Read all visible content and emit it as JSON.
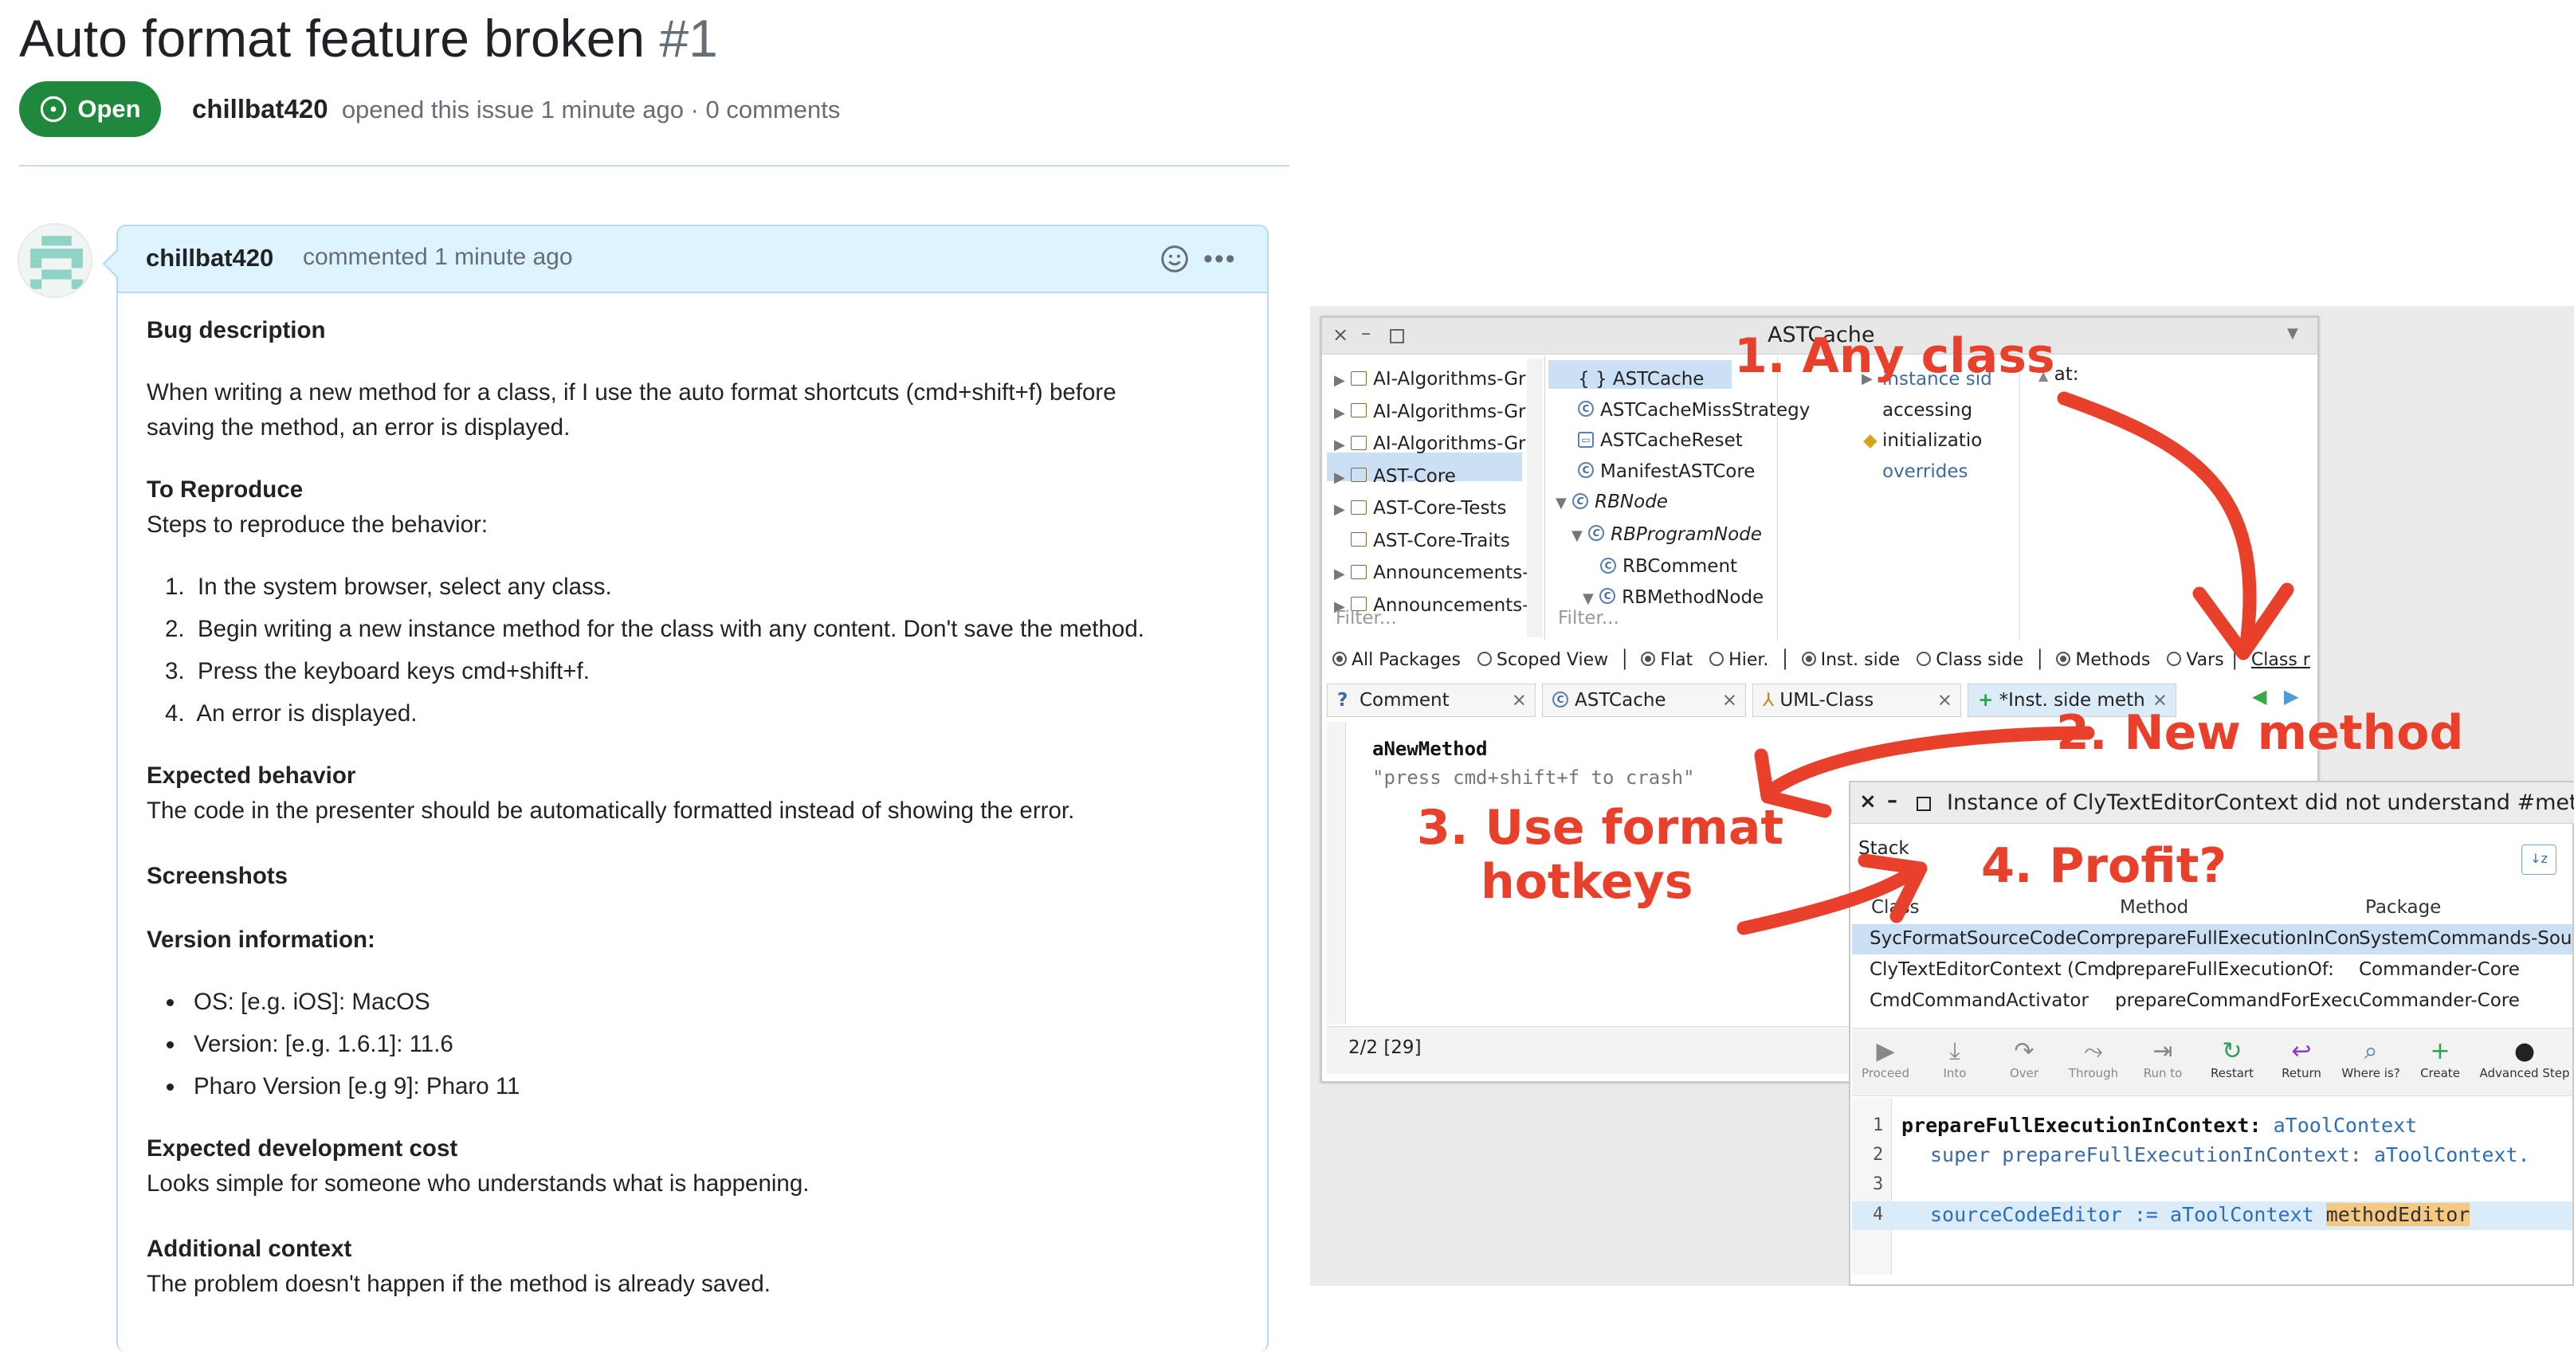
{
  "issue": {
    "title": "Auto format feature broken",
    "number": "#1",
    "status": "Open",
    "author": "chillbat420",
    "opened_text": "opened this issue 1 minute ago · 0 comments"
  },
  "comment": {
    "author": "chillbat420",
    "when": "commented 1 minute ago",
    "sections": {
      "bug_heading": "Bug description",
      "bug_line1": "When writing a new method for a class, if I use the auto format shortcuts (cmd+shift+f) before",
      "bug_line2": "saving the method, an error is displayed.",
      "repro_heading": "To Reproduce",
      "repro_intro": "Steps to reproduce the behavior:",
      "steps": [
        "In the system browser, select any class.",
        "Begin writing a new instance method for the class with any content. Don't save the method.",
        "Press the keyboard keys cmd+shift+f.",
        "An error is displayed."
      ],
      "expected_heading": "Expected behavior",
      "expected_text": "The code in the presenter should be automatically formatted instead of showing the error.",
      "screenshots_heading": "Screenshots",
      "version_heading": "Version information:",
      "version_items": [
        "OS: [e.g. iOS]: MacOS",
        "Version: [e.g. 1.6.1]: 11.6",
        "Pharo Version [e.g 9]: Pharo 11"
      ],
      "cost_heading": "Expected development cost",
      "cost_text": "Looks simple for someone who understands what is happening.",
      "context_heading": "Additional context",
      "context_text": "The problem doesn't happen if the method is already saved."
    }
  },
  "screenshot": {
    "browser_title": "ASTCache",
    "packages": [
      "AI-Algorithms-Gr",
      "AI-Algorithms-Gr",
      "AI-Algorithms-Gr",
      "AST-Core",
      "AST-Core-Tests",
      "AST-Core-Traits",
      "Announcements-",
      "Announcements-"
    ],
    "classes": [
      "{ } ASTCache",
      "ASTCacheMissStrategy",
      "ASTCacheReset",
      "ManifestASTCore",
      "RBNode",
      "RBProgramNode",
      "RBComment",
      "RBMethodNode"
    ],
    "protocols": [
      "instance sid",
      "accessing",
      "initializatio",
      "overrides"
    ],
    "methods": [
      "at:"
    ],
    "filter": "Filter...",
    "toggles": [
      "All Packages",
      "Scoped View",
      "Flat",
      "Hier.",
      "Inst. side",
      "Class side",
      "Methods",
      "Vars",
      "Class r"
    ],
    "tabs": [
      "Comment",
      "ASTCache",
      "UML-Class",
      "*Inst. side meth"
    ],
    "editor_method": "aNewMethod",
    "editor_comment": "\"press cmd+shift+f to crash\"",
    "status": "2/2 [29]",
    "annotations": [
      "1. Any class",
      "2. New method",
      "3. Use format",
      "hotkeys",
      "4. Profit?"
    ],
    "debugger": {
      "title": "Instance of ClyTextEditorContext did not understand #meth",
      "stack_label": "Stack",
      "columns": [
        "Class",
        "Method",
        "Package"
      ],
      "rows": [
        [
          "SycFormatSourceCodeComm",
          "prepareFullExecutionInConte",
          "SystemCommands-Sour"
        ],
        [
          "ClyTextEditorContext (CmdTe",
          "prepareFullExecutionOf:",
          "Commander-Core"
        ],
        [
          "CmdCommandActivator",
          "prepareCommandForExecuti",
          "Commander-Core"
        ]
      ],
      "toolbar": [
        "Proceed",
        "Into",
        "Over",
        "Through",
        "Run to",
        "Restart",
        "Return",
        "Where is?",
        "Create",
        "Advanced Step"
      ],
      "code_lines": [
        {
          "n": "1",
          "a": "prepareFullExecutionInContext: ",
          "b": "aToolContext"
        },
        {
          "n": "2",
          "a": "super prepareFullExecutionInContext: ",
          "b": "aToolContext."
        },
        {
          "n": "3",
          "a": "",
          "b": ""
        },
        {
          "n": "4",
          "a": "sourceCodeEditor := ",
          "b": "aToolContext",
          "c": "methodEditor"
        }
      ]
    }
  }
}
